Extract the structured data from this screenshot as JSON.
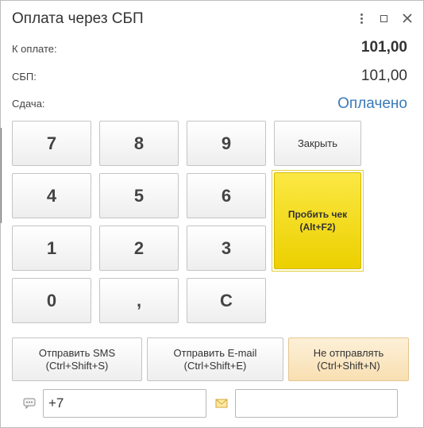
{
  "window": {
    "title": "Оплата через СБП",
    "more_icon": "more-vertical-icon",
    "maximize_icon": "maximize-icon",
    "close_icon": "close-icon"
  },
  "summary": {
    "due_label": "К оплате:",
    "due_value": "101,00",
    "sbp_label": "СБП:",
    "sbp_value": "101,00",
    "change_label": "Сдача:",
    "change_value": "Оплачено",
    "change_color": "#3a7bb8"
  },
  "keypad": {
    "k7": "7",
    "k8": "8",
    "k9": "9",
    "k4": "4",
    "k5": "5",
    "k6": "6",
    "k1": "1",
    "k2": "2",
    "k3": "3",
    "k0": "0",
    "comma": ",",
    "clear": "C"
  },
  "actions": {
    "close_label": "Закрыть",
    "print_line1": "Пробить чек",
    "print_line2": "(Alt+F2)",
    "print_color": "#f3dc1e"
  },
  "send": {
    "sms_line1": "Отправить SMS",
    "sms_line2": "(Ctrl+Shift+S)",
    "email_line1": "Отправить E-mail",
    "email_line2": "(Ctrl+Shift+E)",
    "none_line1": "Не отправлять",
    "none_line2": "(Ctrl+Shift+N)"
  },
  "contact": {
    "phone_value": "+7",
    "email_value": "",
    "phone_icon": "chat-icon",
    "email_icon": "envelope-icon"
  }
}
